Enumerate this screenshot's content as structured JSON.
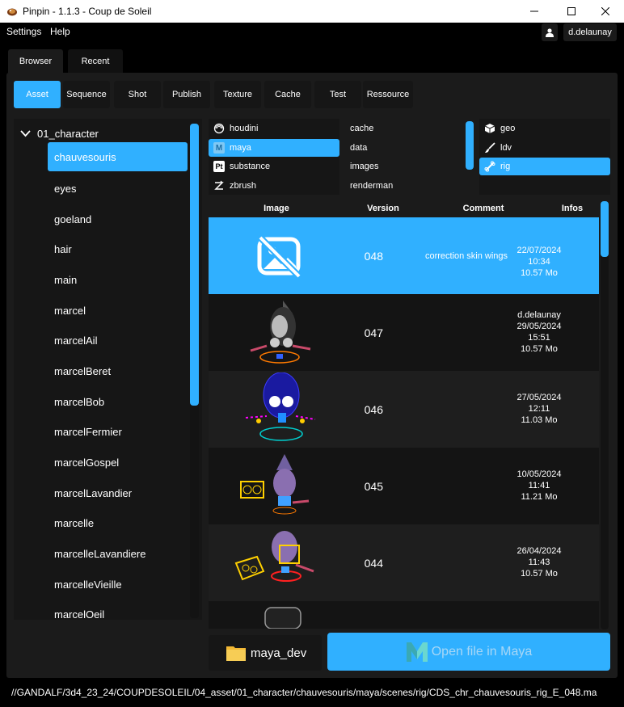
{
  "window": {
    "title": "Pinpin - 1.1.3 - Coup de Soleil"
  },
  "menu": [
    "Settings",
    "Help"
  ],
  "user": {
    "name": "d.delaunay"
  },
  "main_tabs": [
    "Browser",
    "Recent"
  ],
  "type_tabs": [
    "Asset",
    "Sequence",
    "Shot",
    "Publish",
    "Texture",
    "Cache",
    "Test",
    "Ressource"
  ],
  "tree": {
    "root": "01_character",
    "items": [
      "chauvesouris",
      "eyes",
      "goeland",
      "hair",
      "main",
      "marcel",
      "marcelAil",
      "marcelBeret",
      "marcelBob",
      "marcelFermier",
      "marcelGospel",
      "marcelLavandier",
      "marcelle",
      "marcelleLavandiere",
      "marcelleVieille",
      "marcelOeil"
    ]
  },
  "software": [
    {
      "label": "houdini",
      "icon": "houdini-icon"
    },
    {
      "label": "maya",
      "icon": "maya-icon"
    },
    {
      "label": "substance",
      "icon": "substance-icon"
    },
    {
      "label": "zbrush",
      "icon": "zbrush-icon"
    }
  ],
  "folders": [
    "cache",
    "data",
    "images",
    "renderman"
  ],
  "tasks": [
    {
      "label": "geo",
      "icon": "cube-icon"
    },
    {
      "label": "ldv",
      "icon": "brush-icon"
    },
    {
      "label": "rig",
      "icon": "bone-icon"
    }
  ],
  "table": {
    "headers": [
      "Image",
      "Version",
      "Comment",
      "Infos"
    ],
    "rows": [
      {
        "version": "048",
        "comment": "correction skin wings",
        "info": [
          "22/07/2024",
          "10:34",
          "10.57 Mo"
        ]
      },
      {
        "version": "047",
        "comment": "",
        "info": [
          "d.delaunay",
          "29/05/2024",
          "15:51",
          "10.57 Mo"
        ]
      },
      {
        "version": "046",
        "comment": "",
        "info": [
          "27/05/2024",
          "12:11",
          "11.03 Mo"
        ]
      },
      {
        "version": "045",
        "comment": "",
        "info": [
          "10/05/2024",
          "11:41",
          "11.21 Mo"
        ]
      },
      {
        "version": "044",
        "comment": "",
        "info": [
          "26/04/2024",
          "11:43",
          "10.57 Mo"
        ]
      },
      {
        "version": "",
        "comment": "",
        "info": []
      }
    ]
  },
  "footer": {
    "dev_folder": "maya_dev",
    "open_button": "Open file in Maya",
    "path": "//GANDALF/3d4_23_24/COUPDESOLEIL/04_asset/01_character/chauvesouris/maya/scenes/rig/CDS_chr_chauvesouris_rig_E_048.ma"
  },
  "colors": {
    "accent": "#30b0ff",
    "background": "#000000",
    "panel": "#1b1b1b"
  }
}
